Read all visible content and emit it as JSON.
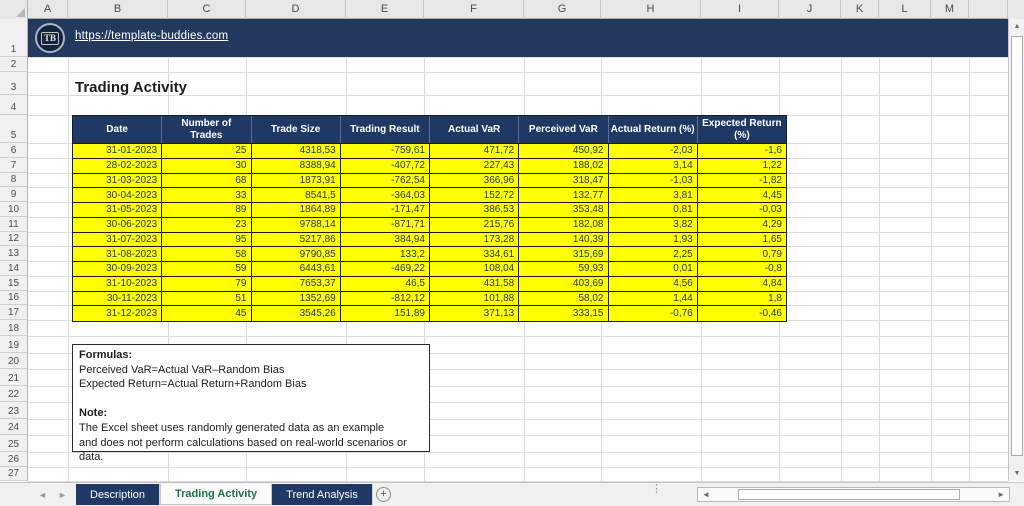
{
  "banner": {
    "url": "https://template-buddies.com",
    "logo_text": "TB"
  },
  "title": "Trading Activity",
  "grid": {
    "column_letters": [
      "A",
      "B",
      "C",
      "D",
      "E",
      "F",
      "G",
      "H",
      "I",
      "J",
      "K",
      "L",
      "M",
      ""
    ],
    "row_numbers": [
      1,
      2,
      3,
      4,
      5,
      6,
      7,
      8,
      9,
      10,
      11,
      12,
      13,
      14,
      15,
      16,
      17,
      18,
      19,
      20,
      21,
      22,
      23,
      24,
      25,
      26,
      27
    ]
  },
  "table": {
    "headers": [
      "Date",
      "Number of Trades",
      "Trade Size",
      "Trading Result",
      "Actual VaR",
      "Perceived VaR",
      "Actual Return (%)",
      "Expected Return (%)"
    ],
    "rows": [
      [
        "31-01-2023",
        "25",
        "4318,53",
        "-759,61",
        "471,72",
        "450,92",
        "-2,03",
        "-1,6"
      ],
      [
        "28-02-2023",
        "30",
        "8388,94",
        "-407,72",
        "227,43",
        "188,02",
        "3,14",
        "1,22"
      ],
      [
        "31-03-2023",
        "68",
        "1873,91",
        "-762,54",
        "366,96",
        "318,47",
        "-1,03",
        "-1,82"
      ],
      [
        "30-04-2023",
        "33",
        "8541,5",
        "-364,03",
        "152,72",
        "132,77",
        "3,81",
        "4,45"
      ],
      [
        "31-05-2023",
        "89",
        "1864,89",
        "-171,47",
        "386,53",
        "353,48",
        "0,81",
        "-0,03"
      ],
      [
        "30-06-2023",
        "23",
        "9788,14",
        "-871,71",
        "215,76",
        "182,08",
        "3,82",
        "4,29"
      ],
      [
        "31-07-2023",
        "95",
        "5217,86",
        "384,94",
        "173,28",
        "140,39",
        "1,93",
        "1,65"
      ],
      [
        "31-08-2023",
        "58",
        "9790,85",
        "133,2",
        "334,61",
        "315,69",
        "2,25",
        "0,79"
      ],
      [
        "30-09-2023",
        "59",
        "6443,61",
        "-469,22",
        "108,04",
        "59,93",
        "0,01",
        "-0,8"
      ],
      [
        "31-10-2023",
        "79",
        "7653,37",
        "46,5",
        "431,58",
        "403,69",
        "4,56",
        "4,84"
      ],
      [
        "30-11-2023",
        "51",
        "1352,69",
        "-812,12",
        "101,88",
        "58,02",
        "1,44",
        "1,8"
      ],
      [
        "31-12-2023",
        "45",
        "3545,26",
        "151,89",
        "371,13",
        "333,15",
        "-0,76",
        "-0,46"
      ]
    ]
  },
  "notes": {
    "formulas_label": "Formulas:",
    "formula1": "Perceived VaR=Actual VaR–Random Bias",
    "formula2": "Expected Return=Actual Return+Random Bias",
    "note_label": "Note:",
    "note1": "The Excel sheet uses randomly generated data as an example",
    "note2": "and does not perform calculations based on real-world scenarios or data."
  },
  "sheet_tabs": [
    {
      "label": "Description",
      "active": false
    },
    {
      "label": "Trading Activity",
      "active": true
    },
    {
      "label": "Trend Analysis",
      "active": false
    }
  ],
  "icons": {
    "tab_nav_left": "◄",
    "tab_nav_right": "►",
    "scroll_up": "▲",
    "scroll_down": "▼",
    "scroll_left": "◄",
    "scroll_right": "►",
    "add_sheet": "+",
    "tab_separator": "⋮"
  },
  "colors": {
    "banner": "#24395E",
    "table_header": "#1F3864",
    "cell_bg": "#FFFF00",
    "cell_text": "#1F3864",
    "active_tab_text": "#1E7145"
  }
}
